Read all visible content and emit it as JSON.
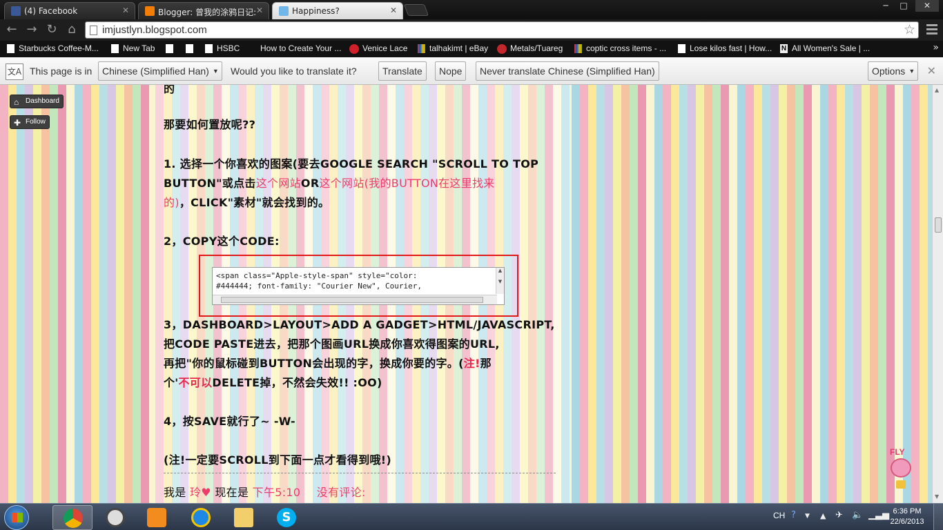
{
  "tabs": [
    {
      "title": "(4) Facebook",
      "favicon": "facebook-icon",
      "color": "#3b5998"
    },
    {
      "title": "Blogger: 曾我的涂鸦日记:",
      "favicon": "blogger-icon",
      "color": "#f57d00"
    },
    {
      "title": "Happiness?",
      "favicon": "page-icon",
      "color": "#6fb7e8"
    }
  ],
  "window_controls": {
    "minimize": "─",
    "maximize": "□",
    "close": "✕"
  },
  "address_bar": {
    "url": "imjustlyn.blogspot.com"
  },
  "bookmarks": [
    {
      "label": "Starbucks Coffee-M..."
    },
    {
      "label": "New Tab"
    },
    {
      "label": ""
    },
    {
      "label": "HSBC"
    },
    {
      "label": "How to Create Your ..."
    },
    {
      "label": "Venice Lace"
    },
    {
      "label": "talhakimt | eBay"
    },
    {
      "label": "Metals/Tuareg"
    },
    {
      "label": "coptic cross items - ..."
    },
    {
      "label": "Lose kilos fast | How..."
    },
    {
      "label": "All Women's Sale | ..."
    }
  ],
  "translate_bar": {
    "prefix": "This page is in",
    "language": "Chinese (Simplified Han)",
    "question": "Would you like to translate it?",
    "translate": "Translate",
    "nope": "Nope",
    "never": "Never translate Chinese (Simplified Han)",
    "options": "Options"
  },
  "blog_nav": {
    "dashboard": "Dashboard",
    "follow": "Follow"
  },
  "post": {
    "top_fragment": "的",
    "question": "那要如何置放呢??",
    "step1_a": "1. 选择一个你喜欢的图案(要去GOOGLE SEARCH \"SCROLL TO TOP",
    "step1_b_1": "BUTTON\"或点击",
    "step1_b_link1": "这个网站",
    "step1_b_or": "OR",
    "step1_b_link2": "这个网站(我的BUTTON在这里找来",
    "step1_c_red": "的)",
    "step1_c_rest": "，CLICK\"素材\"就会找到的。",
    "step2": "2，COPY这个CODE:",
    "code_line1": "<span class=\"Apple-style-span\" style=\"color:",
    "code_line2": "#444444; font-family: \"Courier New\", Courier,",
    "step3_a": "3，DASHBOARD>LAYOUT>ADD A GADGET>HTML/JAVASCRIPT,",
    "step3_b": "把CODE PASTE进去，把那个图画URL换成你喜欢得图案的URL,",
    "step3_c_1": "再把\"你的鼠标碰到BUTTON会出现的字，换成你要的字。(",
    "step3_c_red": "注!",
    "step3_c_2": "那",
    "step3_d_1": "个'",
    "step3_d_red": "不可以",
    "step3_d_2": "DELETE掉，不然会失效!! :OO)",
    "step4": "4，按SAVE就行了~ -W-",
    "note": "(注!一定要SCROLL到下面一点才看得到哦!)",
    "footer_prefix": "我是",
    "footer_author": "玲♥",
    "footer_mid": "现在是",
    "footer_time": "下午5:10",
    "footer_comments": "没有评论:"
  },
  "fly_widget": {
    "label": "FLY"
  },
  "taskbar": {
    "apps": [
      "chrome-icon",
      "clock-app-icon",
      "media-player-icon",
      "internet-explorer-icon",
      "file-explorer-icon",
      "skype-icon"
    ],
    "language": "CH",
    "time": "6:36 PM",
    "date": "22/6/2013"
  }
}
